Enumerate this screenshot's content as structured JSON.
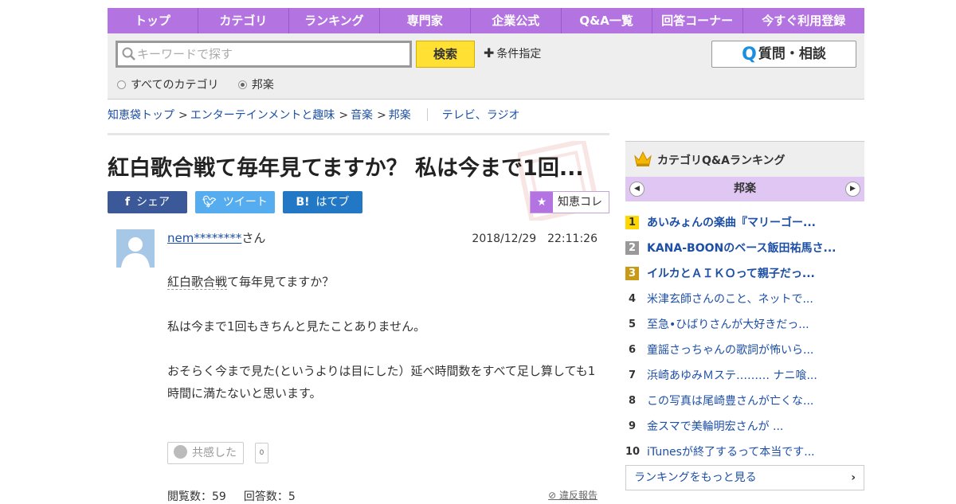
{
  "nav": [
    "トップ",
    "カテゴリ",
    "ランキング",
    "専門家",
    "企業公式",
    "Q&A一覧",
    "回答コーナー",
    "今すぐ利用登録"
  ],
  "search": {
    "placeholder": "キーワードで探す",
    "button": "検索",
    "conditions": "条件指定",
    "ask_button": "質問・相談"
  },
  "radios": [
    {
      "label": "すべてのカテゴリ",
      "selected": false
    },
    {
      "label": "邦楽",
      "selected": true
    }
  ],
  "breadcrumb": {
    "items": [
      "知恵袋トップ",
      "エンターテインメントと趣味",
      "音楽",
      "邦楽"
    ],
    "sep": ">",
    "related": "テレビ、ラジオ"
  },
  "question": {
    "title": "紅白歌合戦て毎年見てますか？ 私は今まで1回...",
    "share": {
      "facebook": "シェア",
      "twitter": "ツイート",
      "hatena": "はてブ",
      "collection": "知恵コレ"
    },
    "user": "nem********",
    "user_suffix": "さん",
    "date": "2018/12/29　22:11:26",
    "body_line1_link": "紅白歌合戦",
    "body_line1_rest": "て毎年見てますか？",
    "body_line2": "私は今まで1回もきちんと見たことありません。",
    "body_line3": "おそらく今まで見た(というよりは目にした）延べ時間数をすべて足し算しても1時間に満たないと思います。",
    "empathy_label": "共感した",
    "empathy_count": "0",
    "views": "閲覧数：59",
    "answers": "回答数：5",
    "report": "違反報告"
  },
  "sidebar": {
    "title": "カテゴリQ&Aランキング",
    "category": "邦楽",
    "ranking": [
      {
        "rank": "1",
        "text": "あいみょんの楽曲『マリーゴー..."
      },
      {
        "rank": "2",
        "text": "KANA-BOONのベース飯田祐馬さ..."
      },
      {
        "rank": "3",
        "text": "イルカとＡＩＫＯって親子だっ..."
      },
      {
        "rank": "4",
        "text": "米津玄師さんのこと、ネットで..."
      },
      {
        "rank": "5",
        "text": "至急•ひばりさんが大好きだっ..."
      },
      {
        "rank": "6",
        "text": "童謡さっちゃんの歌詞が怖いら..."
      },
      {
        "rank": "7",
        "text": "浜崎あゆみＭステ……… ナニ喰..."
      },
      {
        "rank": "8",
        "text": "この写真は尾崎豊さんが亡くな..."
      },
      {
        "rank": "9",
        "text": "金スマで美輪明宏さんが ..."
      },
      {
        "rank": "10",
        "text": "iTunesが終了するって本当です..."
      }
    ],
    "more": "ランキングをもっと見る"
  },
  "colors": {
    "nav": "#b373e0",
    "link": "#1d4fa6",
    "search_button": "#ffe033"
  }
}
